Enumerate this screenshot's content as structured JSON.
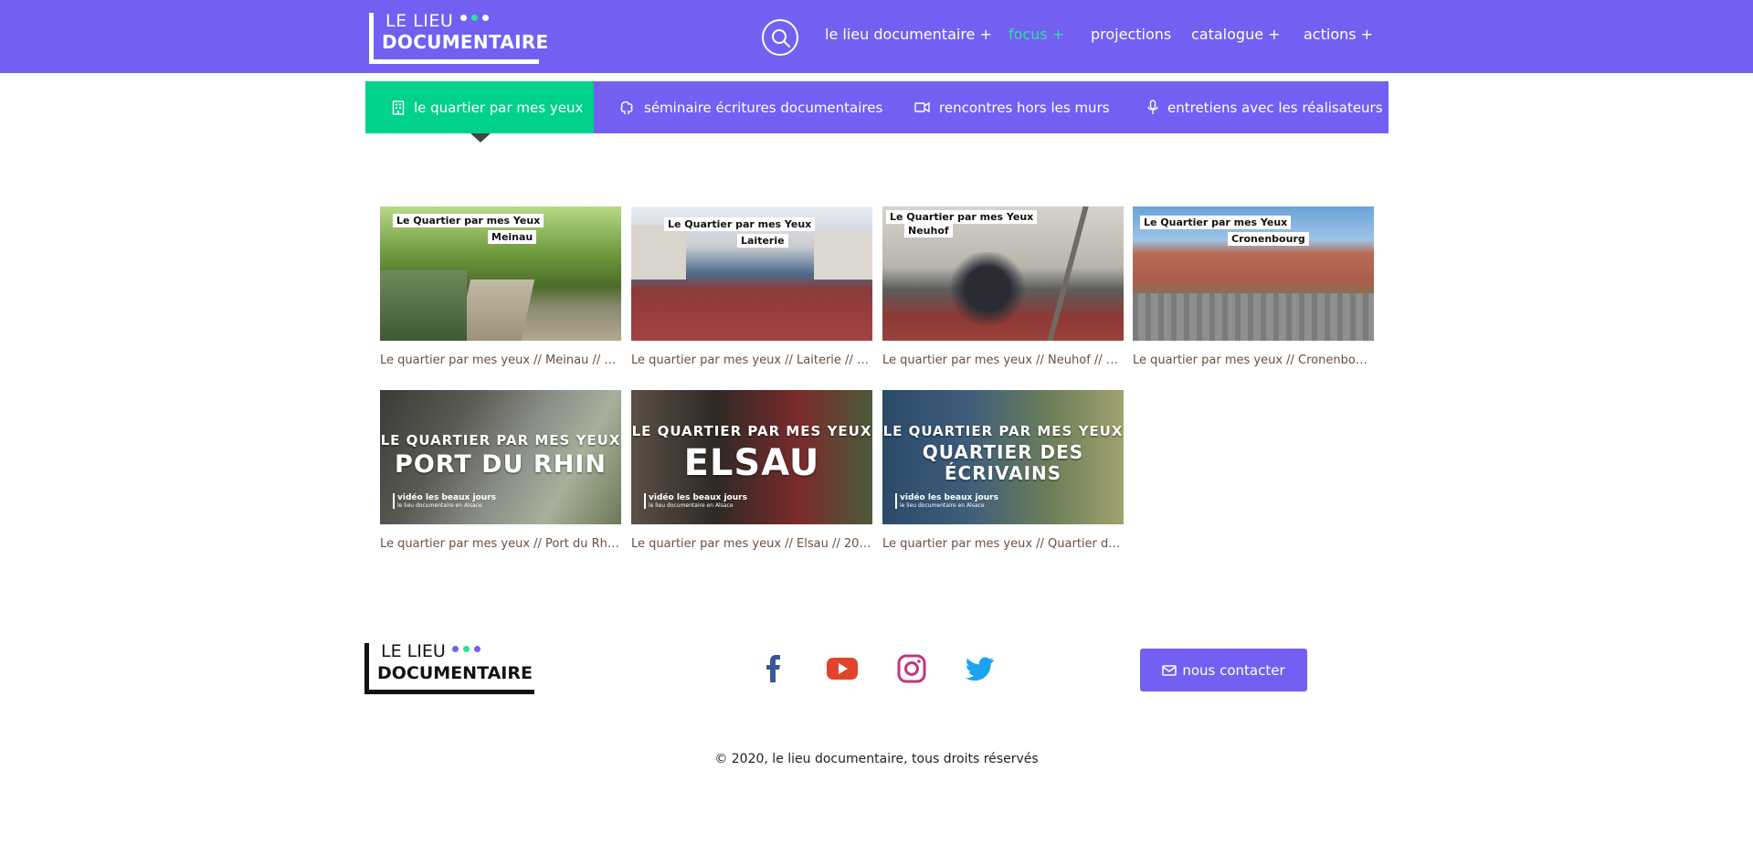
{
  "header": {
    "logo": {
      "line1": "LE LIEU",
      "line2": "DOCUMENTAIRE",
      "dot_colors": [
        "#ffffff",
        "#2ddf9a",
        "#ffffff"
      ]
    },
    "search_icon": "search-icon",
    "nav": [
      {
        "label": "le lieu documentaire +",
        "active": false
      },
      {
        "label": "focus +",
        "active": true
      },
      {
        "label": "projections",
        "active": false
      },
      {
        "label": "catalogue +",
        "active": false
      },
      {
        "label": "actions +",
        "active": false
      }
    ]
  },
  "tabs": [
    {
      "label": "le quartier par mes yeux",
      "icon": "building-icon",
      "active": true
    },
    {
      "label": "séminaire écritures documentaires",
      "icon": "brain-icon",
      "active": false
    },
    {
      "label": "rencontres hors les murs",
      "icon": "video-camera-icon",
      "active": false
    },
    {
      "label": "entretiens avec les réalisateurs",
      "icon": "microphone-icon",
      "active": false
    }
  ],
  "videos": [
    {
      "caption": "Le quartier par mes yeux // Meinau // 2...",
      "thumb_line1": "Le Quartier par mes Yeux",
      "thumb_line2": "Meinau"
    },
    {
      "caption": "Le quartier par mes yeux // Laiterie // 2...",
      "thumb_line1": "Le Quartier par mes Yeux",
      "thumb_line2": "Laiterie"
    },
    {
      "caption": "Le quartier par mes yeux // Neuhof // 2...",
      "thumb_line1": "Le Quartier par mes Yeux",
      "thumb_line2": "Neuhof"
    },
    {
      "caption": "Le quartier par mes yeux // Cronenbour...",
      "thumb_line1": "Le Quartier par mes Yeux",
      "thumb_line2": "Cronenbourg"
    },
    {
      "caption": "Le quartier par mes yeux // Port du Rhi...",
      "thumb_line1": "LE QUARTIER PAR MES YEUX",
      "thumb_line2": "PORT DU RHIN",
      "credit1": "vidéo les beaux jours",
      "credit2": "le lieu documentaire en Alsace"
    },
    {
      "caption": "Le quartier par mes yeux // Elsau // 2019",
      "thumb_line1": "LE QUARTIER PAR MES YEUX",
      "thumb_line2": "ELSAU",
      "credit1": "vidéo les beaux jours",
      "credit2": "le lieu documentaire en Alsace"
    },
    {
      "caption": "Le quartier par mes yeux // Quartier de...",
      "thumb_line1": "LE QUARTIER PAR MES YEUX",
      "thumb_line2": "QUARTIER DES",
      "thumb_line3": "ÉCRIVAINS",
      "credit1": "vidéo les beaux jours",
      "credit2": "le lieu documentaire en Alsace"
    }
  ],
  "footer": {
    "logo": {
      "line1": "LE LIEU",
      "line2": "DOCUMENTAIRE",
      "dot_colors": [
        "#7360f2",
        "#2ddf9a",
        "#7360f2"
      ]
    },
    "social": [
      {
        "icon": "facebook-icon",
        "color": "#3b5998"
      },
      {
        "icon": "youtube-icon",
        "color": "#e0452b"
      },
      {
        "icon": "instagram-icon",
        "color": "#c13584"
      },
      {
        "icon": "twitter-icon",
        "color": "#1da1f2"
      }
    ],
    "contact_label": "nous contacter",
    "copyright": "© 2020, le lieu documentaire, tous droits réservés"
  },
  "colors": {
    "brand": "#7360f2",
    "accent": "#00d18b"
  }
}
